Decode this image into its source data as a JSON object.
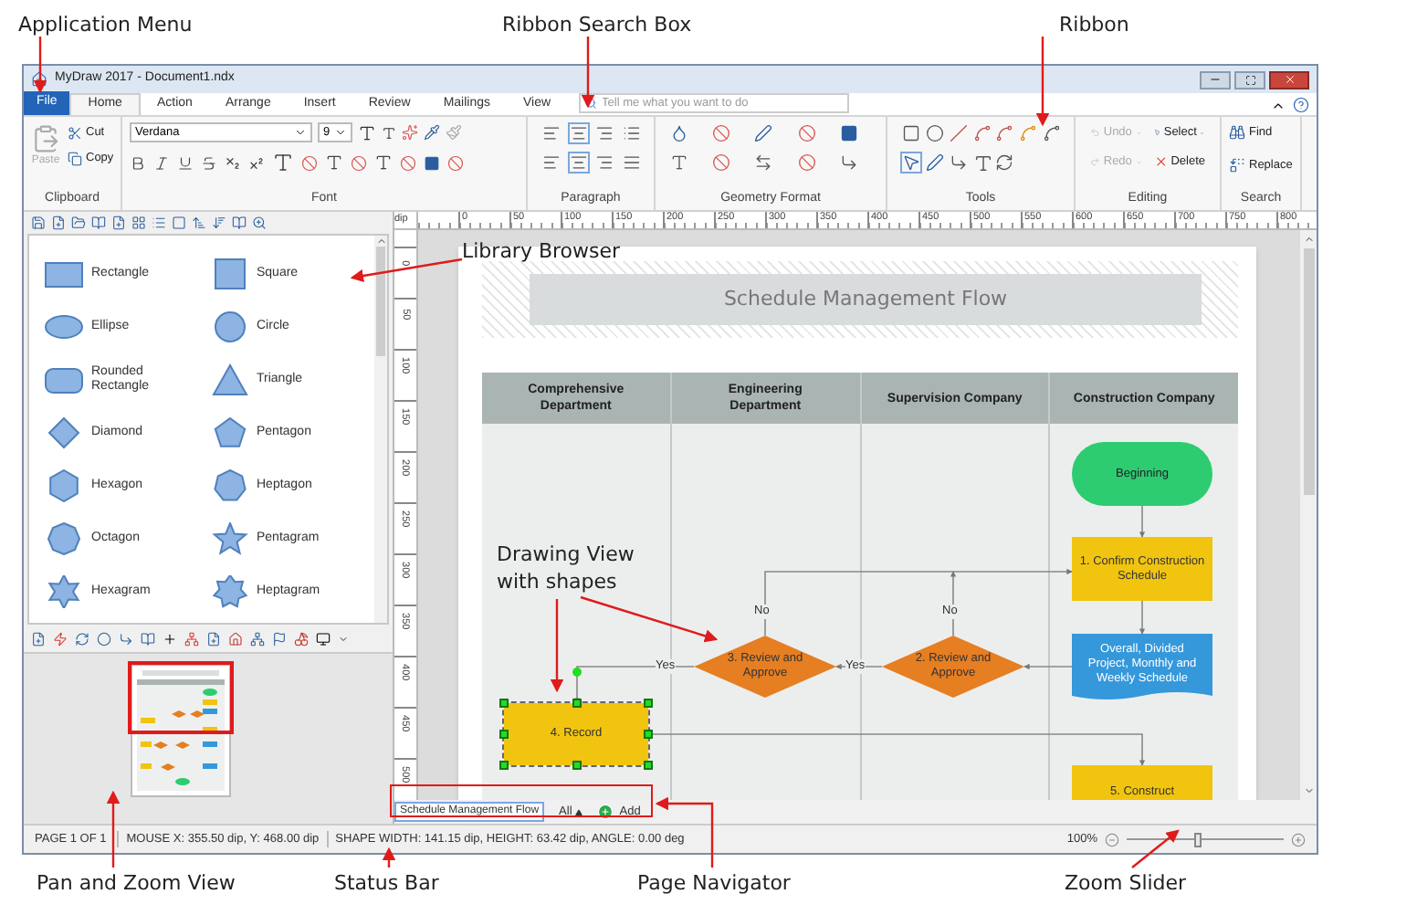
{
  "annotations": [
    {
      "text": "Application Menu"
    },
    {
      "text": "Ribbon Search Box"
    },
    {
      "text": "Ribbon"
    },
    {
      "text": "Library Browser"
    },
    {
      "text": "Drawing View with shapes"
    },
    {
      "text": "Pan and Zoom View"
    },
    {
      "text": "Status Bar"
    },
    {
      "text": "Page Navigator"
    },
    {
      "text": "Zoom Slider"
    }
  ],
  "window": {
    "title": "MyDraw 2017 - Document1.ndx"
  },
  "menu_tabs": [
    {
      "label": "File",
      "kind": "file",
      "selected": false
    },
    {
      "label": "Home",
      "kind": "tab",
      "selected": true
    },
    {
      "label": "Action",
      "kind": "tab",
      "selected": false
    },
    {
      "label": "Arrange",
      "kind": "tab",
      "selected": false
    },
    {
      "label": "Insert",
      "kind": "tab",
      "selected": false
    },
    {
      "label": "Review",
      "kind": "tab",
      "selected": false
    },
    {
      "label": "Mailings",
      "kind": "tab",
      "selected": false
    },
    {
      "label": "View",
      "kind": "tab",
      "selected": false
    }
  ],
  "search": {
    "placeholder": "Tell me what you want to do"
  },
  "ribbon": {
    "groups": [
      {
        "label": "Clipboard",
        "kind": "clipboard",
        "items": [
          {
            "label": "Paste",
            "disabled": true
          },
          {
            "label": "Cut",
            "disabled": false
          },
          {
            "label": "Copy",
            "disabled": false
          }
        ]
      },
      {
        "label": "Font",
        "kind": "font",
        "font": "Verdana",
        "size": "9"
      },
      {
        "label": "Paragraph",
        "kind": "paragraph"
      },
      {
        "label": "Geometry Format",
        "kind": "geometry"
      },
      {
        "label": "Tools",
        "kind": "tools"
      },
      {
        "label": "Editing",
        "kind": "editing",
        "items": [
          {
            "label": "Undo",
            "disabled": true
          },
          {
            "label": "Select",
            "disabled": false
          },
          {
            "label": "Redo",
            "disabled": true
          },
          {
            "label": "Delete",
            "disabled": false
          }
        ]
      },
      {
        "label": "Search",
        "kind": "search",
        "items": [
          {
            "label": "Find"
          },
          {
            "label": "Replace"
          }
        ]
      }
    ]
  },
  "library": {
    "items": [
      {
        "label": "Rectangle",
        "kind": "rectangle"
      },
      {
        "label": "Square",
        "kind": "square"
      },
      {
        "label": "Ellipse",
        "kind": "ellipse"
      },
      {
        "label": "Circle",
        "kind": "circle"
      },
      {
        "label": "Rounded Rectangle",
        "kind": "rounded"
      },
      {
        "label": "Triangle",
        "kind": "triangle"
      },
      {
        "label": "Diamond",
        "kind": "diamond"
      },
      {
        "label": "Pentagon",
        "kind": "pentagon"
      },
      {
        "label": "Hexagon",
        "kind": "hexagon"
      },
      {
        "label": "Heptagon",
        "kind": "heptagon"
      },
      {
        "label": "Octagon",
        "kind": "octagon"
      },
      {
        "label": "Pentagram",
        "kind": "pentagram"
      },
      {
        "label": "Hexagram",
        "kind": "hexagram"
      },
      {
        "label": "Heptagram",
        "kind": "heptagram"
      }
    ]
  },
  "ruler": {
    "unit": "dip",
    "x_labels": [
      "0",
      "50",
      "100",
      "150",
      "200",
      "250",
      "300",
      "350",
      "400",
      "450",
      "500",
      "550",
      "600",
      "650",
      "700",
      "750",
      "800"
    ],
    "y_labels": [
      "0",
      "50",
      "100",
      "150",
      "200",
      "250",
      "300",
      "350",
      "400",
      "450",
      "500"
    ]
  },
  "diagram": {
    "title": "Schedule Management Flow",
    "lanes": [
      "Comprehensive Department",
      "Engineering Department",
      "Supervision Company",
      "Construction Company"
    ],
    "nodes": [
      {
        "kind": "terminator",
        "text": "Beginning",
        "selected": false
      },
      {
        "kind": "process",
        "text": "1. Confirm Construction Schedule",
        "selected": false
      },
      {
        "kind": "decision",
        "text": "3. Review and Approve",
        "selected": false
      },
      {
        "kind": "decision",
        "text": "2. Review and Approve",
        "selected": false
      },
      {
        "kind": "document",
        "text": "Overall, Divided Project, Monthly and Weekly Schedule",
        "selected": false
      },
      {
        "kind": "process",
        "text": "4. Record",
        "selected": true
      },
      {
        "kind": "process",
        "text": "5. Construct",
        "selected": false
      }
    ],
    "edge_labels": [
      "No",
      "No",
      "Yes",
      "Yes"
    ]
  },
  "page_navigator": {
    "pages": [
      {
        "label": "Schedule Management Flow",
        "selected": true
      }
    ],
    "filter": "All",
    "add": "Add"
  },
  "status_bar": {
    "page": "PAGE 1 OF 1",
    "mouse": "MOUSE X: 355.50 dip, Y: 468.00 dip",
    "shape": "SHAPE WIDTH: 141.15 dip, HEIGHT: 63.42 dip, ANGLE: 0.00 deg",
    "zoom": "100%"
  },
  "zoom_slider": {
    "level": 0.45
  }
}
